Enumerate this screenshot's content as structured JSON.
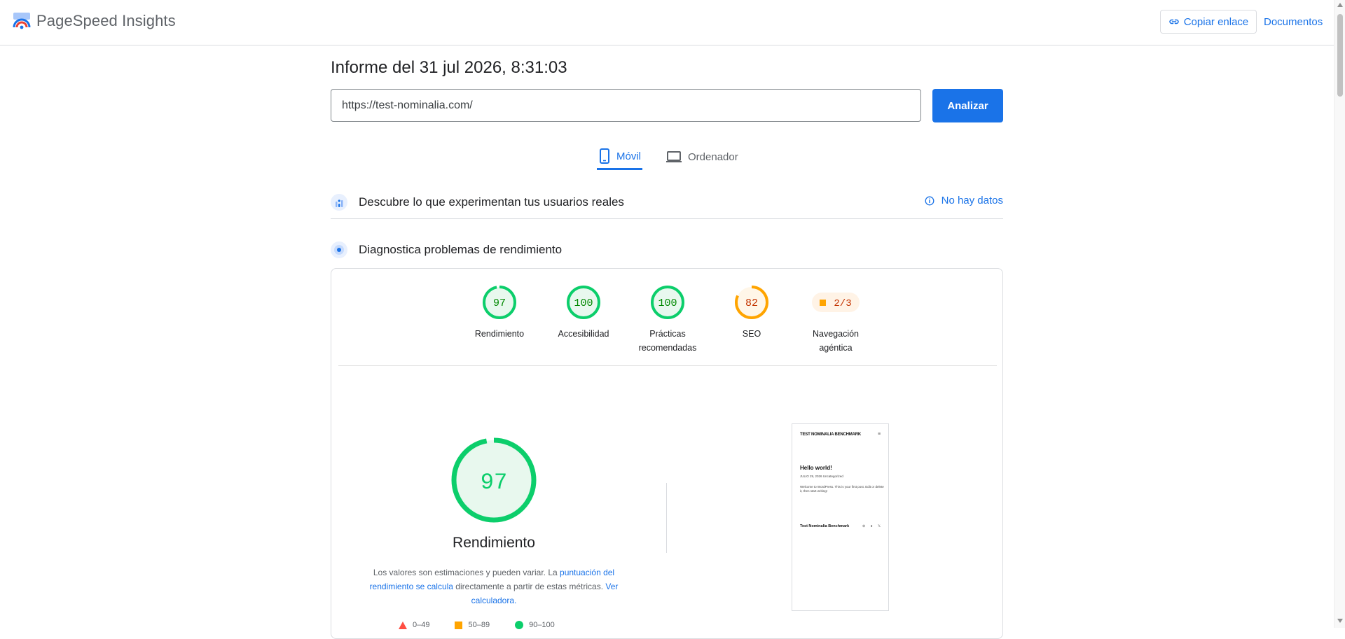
{
  "header": {
    "app_title": "PageSpeed Insights",
    "copy_link_label": "Copiar enlace",
    "docs_label": "Documentos"
  },
  "report": {
    "title": "Informe del 31 jul 2026, 8:31:03",
    "url_value": "https://test-nominalia.com/",
    "analyze_label": "Analizar"
  },
  "tabs": [
    {
      "label": "Móvil",
      "active": true,
      "icon": "smartphone-icon"
    },
    {
      "label": "Ordenador",
      "active": false,
      "icon": "laptop-icon"
    }
  ],
  "sections": {
    "users_title": "Descubre lo que experimentan tus usuarios reales",
    "no_data_label": "No hay datos",
    "diagnose_title": "Diagnostica problemas de rendimiento"
  },
  "categories": [
    {
      "score": "97",
      "label_line1": "Rendimiento",
      "label_line2": "",
      "color": "#0cce6b",
      "bg": "#e8f8ee",
      "text_color": "#008800",
      "fraction": 0.97
    },
    {
      "score": "100",
      "label_line1": "Accesibilidad",
      "label_line2": "",
      "color": "#0cce6b",
      "bg": "#e8f8ee",
      "text_color": "#008800",
      "fraction": 1.0
    },
    {
      "score": "100",
      "label_line1": "Prácticas",
      "label_line2": "recomendadas",
      "color": "#0cce6b",
      "bg": "#e8f8ee",
      "text_color": "#008800",
      "fraction": 1.0
    },
    {
      "score": "82",
      "label_line1": "SEO",
      "label_line2": "",
      "color": "#ffa400",
      "bg": "#fff6e8",
      "text_color": "#c33300",
      "fraction": 0.82
    },
    {
      "score": "2/3",
      "label_line1": "Navegación",
      "label_line2": "agéntica",
      "color": "#ffa400",
      "bg": "#fff3e6",
      "text_color": "#c33300",
      "fraction": null
    }
  ],
  "performance": {
    "score": "97",
    "fraction": 0.97,
    "label": "Rendimiento",
    "desc_part1": "Los valores son estimaciones y pueden variar. La ",
    "desc_link1": "puntuación del rendimiento se calcula",
    "desc_part2": " directamente a partir de estas métricas. ",
    "desc_link2": "Ver calculadora."
  },
  "legend": [
    {
      "range": "0–49",
      "shape": "triangle",
      "color": "#ff4e42"
    },
    {
      "range": "50–89",
      "shape": "square",
      "color": "#ffa400"
    },
    {
      "range": "90–100",
      "shape": "circle",
      "color": "#0cce6b"
    }
  ],
  "thumbnail": {
    "site_title": "TEST NOMINALIA BENCHMARK",
    "menu": "≡",
    "post_title": "Hello world!",
    "post_meta": "JULIO 29, 2026     Uncategorized",
    "post_body": "Welcome to WordPress. This is your first post. Edit or delete it, then start writing!",
    "footer_title": "Test Nominalia Benchmark",
    "social": "⊚ ● 𝕏"
  },
  "colors": {
    "accent": "#1a73e8",
    "pass": "#0cce6b",
    "average": "#ffa400",
    "fail": "#ff4e42"
  }
}
